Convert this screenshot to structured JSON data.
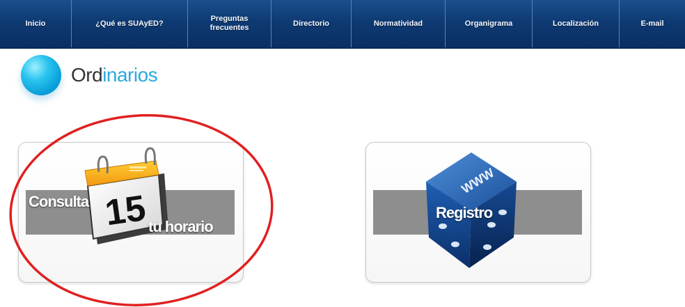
{
  "nav": {
    "items": [
      {
        "label": "Inicio"
      },
      {
        "label": "¿Qué es SUAyED?"
      },
      {
        "label": "Preguntas\nfrecuentes"
      },
      {
        "label": "Directorio"
      },
      {
        "label": "Normatividad"
      },
      {
        "label": "Organigrama"
      },
      {
        "label": "Localización"
      },
      {
        "label": "E-mail"
      }
    ]
  },
  "section": {
    "title_part1": "Ord",
    "title_part2": "inarios"
  },
  "cards": [
    {
      "label_top": "Consulta",
      "label_bottom": "tu horario",
      "calendar_day": "15",
      "icon": "calendar-icon"
    },
    {
      "label": "Registro",
      "icon": "www-dice-icon",
      "cube_text": "WWW"
    }
  ],
  "colors": {
    "nav_bg": "#0e3a72",
    "accent": "#2aa9dd",
    "annotation": "#e02020"
  }
}
